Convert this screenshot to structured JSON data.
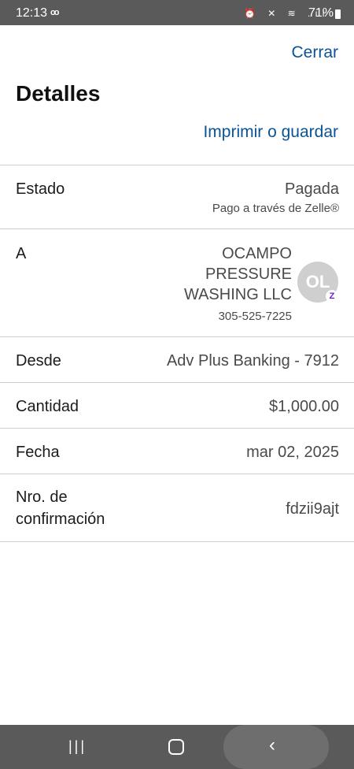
{
  "status_bar": {
    "time": "12:13",
    "voicemail_icon": "voicemail-icon",
    "icons": "⏰ ✕ ≋ .ıl",
    "battery": "71%"
  },
  "header": {
    "close_label": "Cerrar",
    "title": "Detalles",
    "print_label": "Imprimir o guardar"
  },
  "details": {
    "estado": {
      "label": "Estado",
      "value": "Pagada",
      "sub": "Pago a través de Zelle®"
    },
    "recipient": {
      "label": "A",
      "name": "OCAMPO PRESSURE WASHING LLC",
      "phone": "305-525-7225",
      "avatar_initials": "OL",
      "badge": "Z"
    },
    "desde": {
      "label": "Desde",
      "value": "Adv Plus Banking - 7912"
    },
    "cantidad": {
      "label": "Cantidad",
      "value": "$1,000.00"
    },
    "fecha": {
      "label": "Fecha",
      "value": "mar 02, 2025"
    },
    "confirmacion": {
      "label": "Nro. de confirmación",
      "value": "fdzii9ajt"
    }
  },
  "nav_bar": {
    "recent": "|||",
    "back": "‹"
  },
  "colors": {
    "accent": "#0b5394",
    "statusbar": "#5a5a5a",
    "divider": "#cfcfcf",
    "zelle": "#6d1ed4"
  }
}
